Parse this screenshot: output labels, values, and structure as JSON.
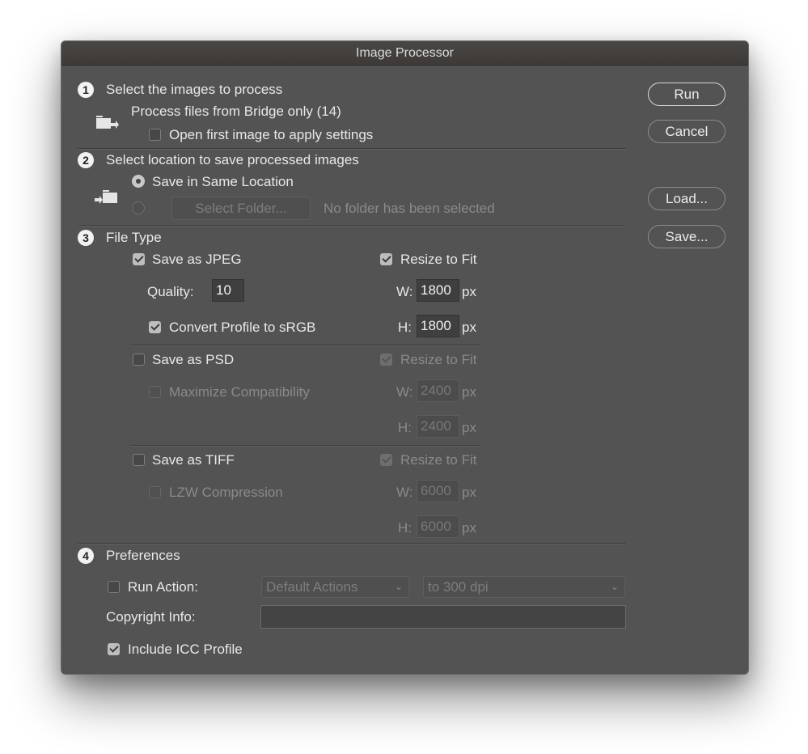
{
  "window": {
    "title": "Image Processor"
  },
  "buttons": {
    "run": "Run",
    "cancel": "Cancel",
    "load": "Load...",
    "save": "Save..."
  },
  "section1": {
    "number": "1",
    "title": "Select the images to process",
    "source_text": "Process files from Bridge only (14)",
    "open_first_image": {
      "label": "Open first image to apply settings",
      "checked": false
    },
    "icon": "folder-arrow-icon"
  },
  "section2": {
    "number": "2",
    "title": "Select location to save processed images",
    "same_location": {
      "label": "Save in Same Location",
      "selected": true
    },
    "select_folder": {
      "label": "Select Folder...",
      "selected": false
    },
    "folder_status": "No folder has been selected",
    "icon": "folder-save-icon"
  },
  "section3": {
    "number": "3",
    "title": "File Type",
    "jpeg": {
      "label": "Save as JPEG",
      "checked": true,
      "quality_label": "Quality:",
      "quality": "10",
      "convert_label": "Convert Profile to sRGB",
      "convert_checked": true,
      "resize_label": "Resize to Fit",
      "resize_checked": true,
      "w_label": "W:",
      "w": "1800",
      "h_label": "H:",
      "h": "1800",
      "unit": "px"
    },
    "psd": {
      "label": "Save as PSD",
      "checked": false,
      "maximize_label": "Maximize Compatibility",
      "maximize_checked": false,
      "resize_label": "Resize to Fit",
      "resize_checked": true,
      "w_label": "W:",
      "w": "2400",
      "h_label": "H:",
      "h": "2400",
      "unit": "px"
    },
    "tiff": {
      "label": "Save as TIFF",
      "checked": false,
      "lzw_label": "LZW Compression",
      "lzw_checked": false,
      "resize_label": "Resize to Fit",
      "resize_checked": true,
      "w_label": "W:",
      "w": "6000",
      "h_label": "H:",
      "h": "6000",
      "unit": "px"
    }
  },
  "section4": {
    "number": "4",
    "title": "Preferences",
    "run_action": {
      "label": "Run Action:",
      "checked": false,
      "set": "Default Actions",
      "action": "to 300 dpi"
    },
    "copyright": {
      "label": "Copyright Info:",
      "value": ""
    },
    "icc": {
      "label": "Include ICC Profile",
      "checked": true
    }
  }
}
